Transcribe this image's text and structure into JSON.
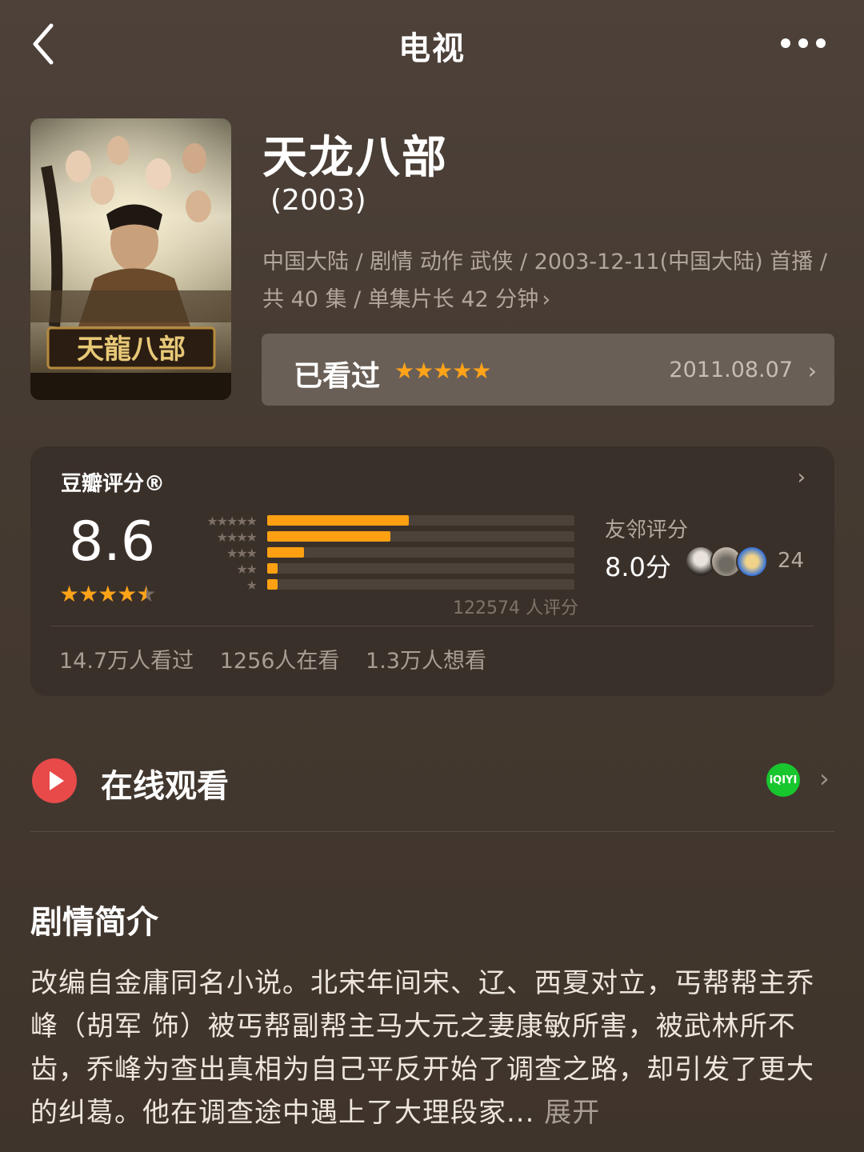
{
  "nav": {
    "title": "电视"
  },
  "movie": {
    "title": "天龙八部",
    "year": "(2003)",
    "meta_line1": "中国大陆 / 剧情 动作 武侠 / 2003-12-11(中国大陆) 首播 /",
    "meta_line2": "共 40 集 / 单集片长 42 分钟",
    "poster_text": "天龍八部"
  },
  "watched": {
    "label": "已看过",
    "stars": "★★★★★",
    "rating": 5,
    "date": "2011.08.07"
  },
  "rating": {
    "title": "豆瓣评分®",
    "score": "8.6",
    "stars": "★★★★★",
    "star_value": 4.5,
    "distribution": [
      {
        "stars": "★★★★★",
        "fraction": 0.46
      },
      {
        "stars": "★★★★",
        "fraction": 0.4
      },
      {
        "stars": "★★★",
        "fraction": 0.12
      },
      {
        "stars": "★★",
        "fraction": 0.035
      },
      {
        "stars": "★",
        "fraction": 0.035
      }
    ],
    "count": "122574 人评分",
    "friend_label": "友邻评分",
    "friend_score": "8.0分",
    "friend_count": "24",
    "stats": [
      "14.7万人看过",
      "1256人在看",
      "1.3万人想看"
    ]
  },
  "online": {
    "label": "在线观看",
    "platform": "iQIYI",
    "colors": {
      "play": "#e84a4a",
      "platform": "#18c62e"
    }
  },
  "synopsis": {
    "title": "剧情简介",
    "text": "改编自金庸同名小说。北宋年间宋、辽、西夏对立，丐帮帮主乔峰（胡军 饰）被丐帮副帮主马大元之妻康敏所害，被武林所不齿，乔峰为查出真相为自己平反开始了调查之路，却引发了更大的纠葛。他在调查途中遇上了大理段家...",
    "more": "展开"
  }
}
